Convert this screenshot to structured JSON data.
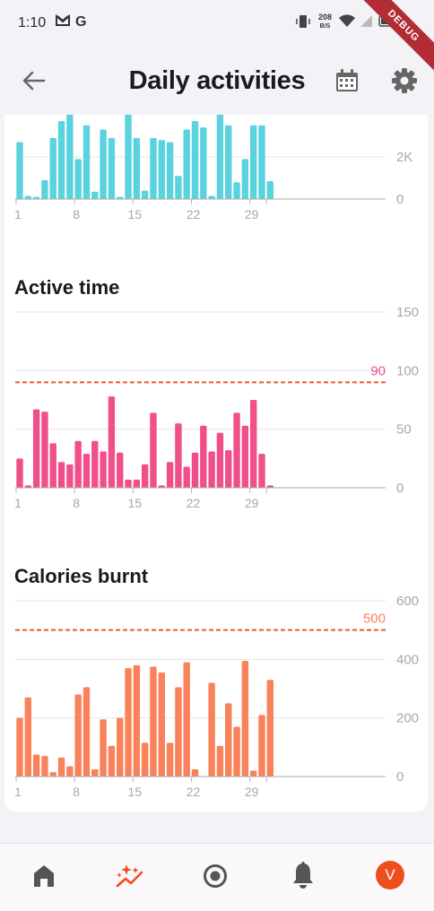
{
  "status_bar": {
    "time": "1:10",
    "icons": [
      "mail-icon",
      "google-icon",
      "vibrate-icon",
      "wifi-icon",
      "signal-icon",
      "battery-icon"
    ],
    "network_speed_value": "208",
    "network_speed_unit": "B/S"
  },
  "debug_banner": "DEBUG",
  "header": {
    "title": "Daily activities",
    "back_icon": "arrow-left-icon",
    "calendar_icon": "calendar-icon",
    "settings_icon": "gear-icon"
  },
  "colors": {
    "steps": "#5ad3de",
    "active_time": "#f0508a",
    "calories": "#f9825a",
    "goal_line": "#ec5a2a",
    "accent": "#ee4d1e"
  },
  "sections": {
    "active_time_title": "Active time",
    "calories_title": "Calories burnt"
  },
  "chart_data": [
    {
      "type": "bar",
      "x": [
        1,
        2,
        3,
        4,
        5,
        6,
        7,
        8,
        9,
        10,
        11,
        12,
        13,
        14,
        15,
        16,
        17,
        18,
        19,
        20,
        21,
        22,
        23,
        24,
        25,
        26,
        27,
        28,
        29,
        30,
        31
      ],
      "values": [
        2700,
        150,
        100,
        900,
        2900,
        3700,
        4100,
        1900,
        3500,
        350,
        3300,
        2900,
        100,
        4200,
        2900,
        400,
        2900,
        2800,
        2700,
        1100,
        3300,
        3700,
        3400,
        150,
        4200,
        3500,
        800,
        1900,
        3500,
        3500,
        850
      ],
      "x_tick_labels": [
        "1",
        "8",
        "15",
        "22",
        "29"
      ],
      "y_tick_labels": [
        "0",
        "2K"
      ],
      "partially_visible": true
    },
    {
      "type": "bar",
      "title": "Active time",
      "x": [
        1,
        2,
        3,
        4,
        5,
        6,
        7,
        8,
        9,
        10,
        11,
        12,
        13,
        14,
        15,
        16,
        17,
        18,
        19,
        20,
        21,
        22,
        23,
        24,
        25,
        26,
        27,
        28,
        29,
        30,
        31
      ],
      "values": [
        25,
        2,
        67,
        65,
        38,
        22,
        20,
        40,
        29,
        40,
        31,
        78,
        30,
        7,
        7,
        20,
        64,
        2,
        22,
        55,
        18,
        30,
        53,
        31,
        47,
        32,
        64,
        53,
        75,
        29,
        2
      ],
      "goal": 90,
      "goal_label": "90",
      "ylim": [
        0,
        150
      ],
      "y_tick_labels": [
        "0",
        "50",
        "100",
        "150"
      ],
      "x_tick_labels": [
        "1",
        "8",
        "15",
        "22",
        "29"
      ]
    },
    {
      "type": "bar",
      "title": "Calories burnt",
      "x": [
        1,
        2,
        3,
        4,
        5,
        6,
        7,
        8,
        9,
        10,
        11,
        12,
        13,
        14,
        15,
        16,
        17,
        18,
        19,
        20,
        21,
        22,
        23,
        24,
        25,
        26,
        27,
        28,
        29,
        30,
        31
      ],
      "values": [
        200,
        270,
        75,
        70,
        15,
        65,
        35,
        280,
        305,
        25,
        195,
        105,
        200,
        370,
        380,
        115,
        375,
        355,
        115,
        305,
        390,
        25,
        0,
        320,
        105,
        250,
        170,
        395,
        20,
        210,
        330
      ],
      "goal": 500,
      "goal_label": "500",
      "ylim": [
        0,
        600
      ],
      "y_tick_labels": [
        "0",
        "200",
        "400",
        "600"
      ],
      "x_tick_labels": [
        "1",
        "8",
        "15",
        "22",
        "29"
      ]
    }
  ],
  "bottom_nav": {
    "items": [
      "home-icon",
      "insights-icon",
      "record-icon",
      "bell-icon"
    ],
    "avatar_letter": "V"
  }
}
